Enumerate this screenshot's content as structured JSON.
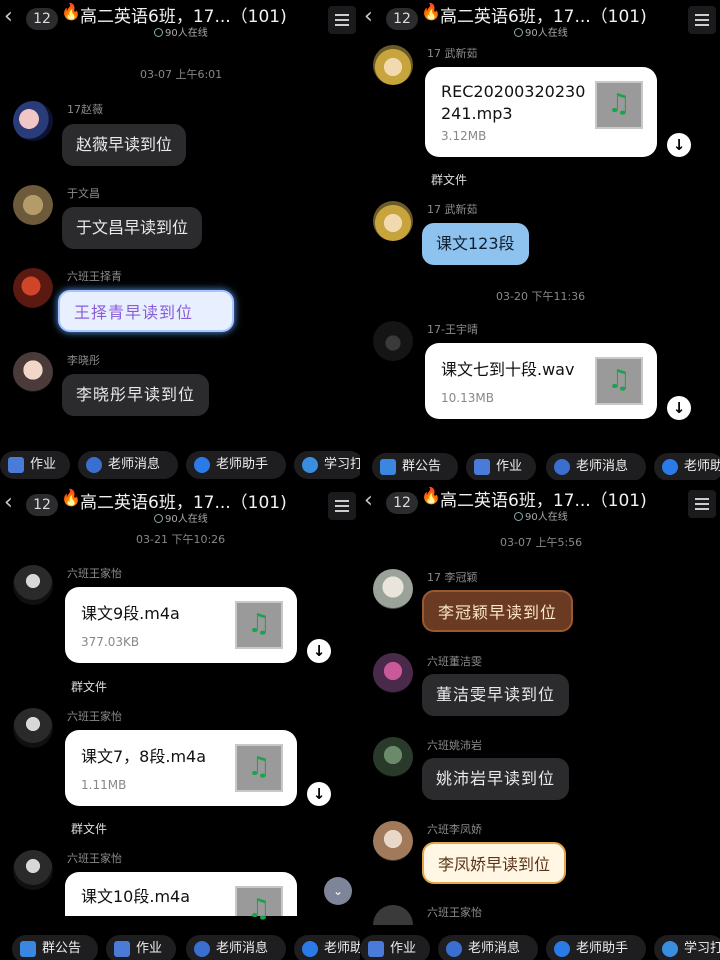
{
  "header": {
    "back_glyph": "‹",
    "unread_badge": "12",
    "fire_glyph": "🔥",
    "title": "高二英语6班，17...（101)",
    "online": "90人在线"
  },
  "panel1": {
    "time": "03-07 上午6:01",
    "messages": [
      {
        "name": "17赵薇",
        "text": "赵薇早读到位"
      },
      {
        "name": "于文昌",
        "text": "于文昌早读到位"
      },
      {
        "name": "六班王择青",
        "text": "王择青早读到位"
      },
      {
        "name": "李晓彤",
        "text": "李晓彤早读到位"
      }
    ],
    "toolbar": [
      "作业",
      "老师消息",
      "老师助手",
      "学习打"
    ]
  },
  "panel2": {
    "file1": {
      "sender": "17 武新茹",
      "filename": "REC20200320230241.mp3",
      "size": "3.12MB"
    },
    "group_file": "群文件",
    "msg": {
      "name": "17 武新茹",
      "text": "课文123段"
    },
    "time": "03-20 下午11:36",
    "file2": {
      "sender": "17-王宇晴",
      "filename": "课文七到十段.wav",
      "size": "10.13MB"
    },
    "toolbar": [
      "群公告",
      "作业",
      "老师消息",
      "老师助"
    ]
  },
  "panel3": {
    "time": "03-21 下午10:26",
    "files": [
      {
        "sender": "六班王家怡",
        "filename": "课文9段.m4a",
        "size": "377.03KB"
      },
      {
        "sender": "六班王家怡",
        "filename": "课文7，8段.m4a",
        "size": "1.11MB"
      },
      {
        "sender": "六班王家怡",
        "filename": "课文10段.m4a",
        "size": ""
      }
    ],
    "group_file": "群文件",
    "toolbar": [
      "群公告",
      "作业",
      "老师消息",
      "老师助"
    ]
  },
  "panel4": {
    "time": "03-07 上午5:56",
    "messages": [
      {
        "name": "17 李冠颖",
        "text": "李冠颖早读到位"
      },
      {
        "name": "六班董洁雯",
        "text": "董洁雯早读到位"
      },
      {
        "name": "六班姚沛岩",
        "text": "姚沛岩早读到位"
      },
      {
        "name": "六班李凤娇",
        "text": "李凤娇早读到位"
      },
      {
        "name": "六班王家怡",
        "text": ""
      }
    ],
    "toolbar": [
      "作业",
      "老师消息",
      "老师助手",
      "学习打"
    ]
  },
  "icons": {
    "download": "↓",
    "music": "♫",
    "scroll_down": "⌄"
  },
  "colors": {
    "chip_homework": "#4a7bd8",
    "chip_teacher_msg": "#3a6fd0",
    "chip_assistant": "#2a7be8",
    "chip_study": "#3a8ee0",
    "chip_notice": "#3a86e0"
  }
}
